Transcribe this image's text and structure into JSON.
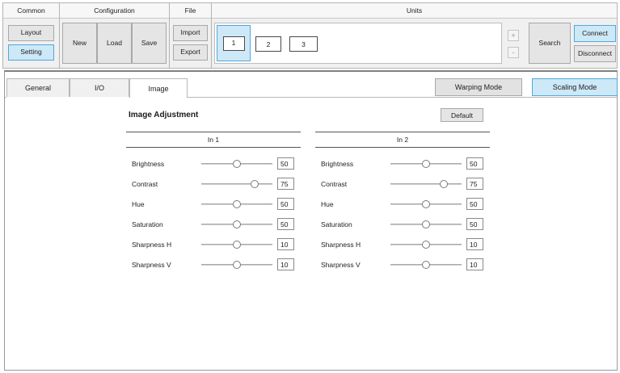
{
  "ribbon": {
    "common": {
      "title": "Common",
      "layout": "Layout",
      "setting": "Setting"
    },
    "configuration": {
      "title": "Configuration",
      "new": "New",
      "load": "Load",
      "save": "Save"
    },
    "file": {
      "title": "File",
      "import": "Import",
      "export": "Export"
    },
    "units": {
      "title": "Units",
      "items": [
        "1",
        "2",
        "3"
      ],
      "selected": "1",
      "plus": "+",
      "minus": "-",
      "search": "Search",
      "connect": "Connect",
      "disconnect": "Disconnect"
    }
  },
  "tabs": [
    "General",
    "I/O",
    "Image"
  ],
  "active_tab": "Image",
  "modes": {
    "warping": "Warping Mode",
    "scaling": "Scaling Mode",
    "selected": "Scaling Mode"
  },
  "image_adjustment": {
    "title": "Image Adjustment",
    "default_label": "Default",
    "columns": [
      {
        "title": "In 1",
        "rows": [
          {
            "label": "Brightness",
            "value": "50",
            "fraction": 0.5
          },
          {
            "label": "Contrast",
            "value": "75",
            "fraction": 0.75
          },
          {
            "label": "Hue",
            "value": "50",
            "fraction": 0.5
          },
          {
            "label": "Saturation",
            "value": "50",
            "fraction": 0.5
          },
          {
            "label": "Sharpness H",
            "value": "10",
            "fraction": 0.5
          },
          {
            "label": "Sharpness V",
            "value": "10",
            "fraction": 0.5
          }
        ]
      },
      {
        "title": "In 2",
        "rows": [
          {
            "label": "Brightness",
            "value": "50",
            "fraction": 0.5
          },
          {
            "label": "Contrast",
            "value": "75",
            "fraction": 0.75
          },
          {
            "label": "Hue",
            "value": "50",
            "fraction": 0.5
          },
          {
            "label": "Saturation",
            "value": "50",
            "fraction": 0.5
          },
          {
            "label": "Sharpness H",
            "value": "10",
            "fraction": 0.5
          },
          {
            "label": "Sharpness V",
            "value": "10",
            "fraction": 0.5
          }
        ]
      }
    ]
  },
  "colors": {
    "selected_fill": "#cde8f7",
    "selected_border": "#52a7dc",
    "button_fill": "#e5e5e5"
  }
}
